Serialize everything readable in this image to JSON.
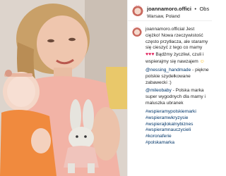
{
  "header": {
    "username": "joannamoro.offici",
    "separator": "•",
    "follow_label": "Obserwowanie",
    "location": "Warsaw, Poland"
  },
  "caption": {
    "username": "joannamoro.official",
    "line1": "Jest ciężko! Nowa rzeczywistość często przytłacza, ale staramy się cieszyć z tego co mamy",
    "line2": "Bądźmy życzliwi, czuli i wspierajmy się nawzajem",
    "mention1": "@nessing_handmade",
    "line3": " - piękne polskie szydełkowane zabawecki :) ",
    "mention2": "@mileobaby",
    "line4": " - Polska marka super wygodnych dla mamy i maluszka ubranek",
    "hashtags": [
      "#wspieramypolskiemarki",
      "#wspieramwkryzysie",
      "#wspierajlokalnybiznes",
      "#wspieramnauczycieli",
      "#koronaferie",
      "#polskamarka"
    ],
    "heart_emoji": "♥♥♥",
    "smile_emoji": "☺"
  },
  "colors": {
    "accent_blue": "#003569",
    "text": "#262626",
    "heart": "#e0245e"
  }
}
